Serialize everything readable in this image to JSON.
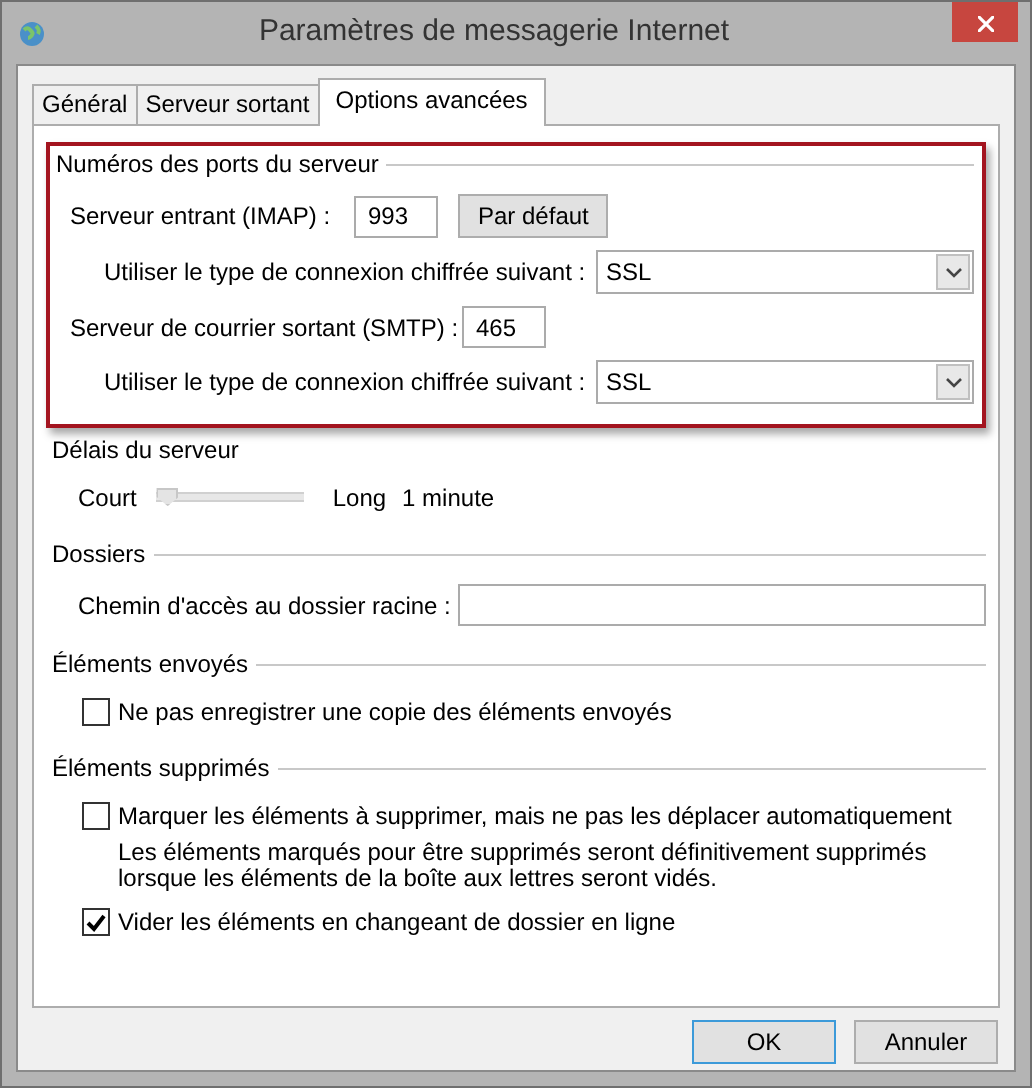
{
  "window": {
    "title": "Paramètres de messagerie Internet"
  },
  "tabs": [
    {
      "label": "Général",
      "selected": false
    },
    {
      "label": "Serveur sortant",
      "selected": false
    },
    {
      "label": "Options avancées",
      "selected": true
    }
  ],
  "ports": {
    "title": "Numéros des ports du serveur",
    "highlighted": true,
    "incoming_label": "Serveur entrant (IMAP) :",
    "incoming_port": "993",
    "default_button": "Par défaut",
    "incoming_encryption_label": "Utiliser le type de connexion chiffrée suivant :",
    "incoming_encryption": "SSL",
    "outgoing_label": "Serveur de courrier sortant (SMTP) :",
    "outgoing_port": "465",
    "outgoing_encryption_label": "Utiliser le type de connexion chiffrée suivant :",
    "outgoing_encryption": "SSL"
  },
  "timeout": {
    "title": "Délais du serveur",
    "min_label": "Court",
    "max_label": "Long",
    "level": 0,
    "reading": "1 minute"
  },
  "folders": {
    "title": "Dossiers",
    "root_path_label": "Chemin d'accès au dossier racine :"
  },
  "sent_items": {
    "title": "Éléments envoyés",
    "options": [
      {
        "kind": "checkbox",
        "label": "Ne pas enregistrer une copie des éléments envoyés",
        "checked": false
      }
    ]
  },
  "deleted_items": {
    "title": "Éléments supprimés",
    "options": [
      {
        "kind": "checkbox",
        "label": "Marquer les éléments à supprimer, mais ne pas les déplacer automatiquement",
        "checked": false
      },
      {
        "kind": "note",
        "text": "Les éléments marqués pour être supprimés seront définitivement supprimés lorsque les éléments de la boîte aux lettres seront vidés."
      },
      {
        "kind": "checkbox",
        "label": "Vider les éléments en changeant de dossier en ligne",
        "checked": true
      }
    ]
  },
  "buttons": [
    {
      "label": "OK",
      "default": true
    },
    {
      "label": "Annuler",
      "default": false
    }
  ]
}
